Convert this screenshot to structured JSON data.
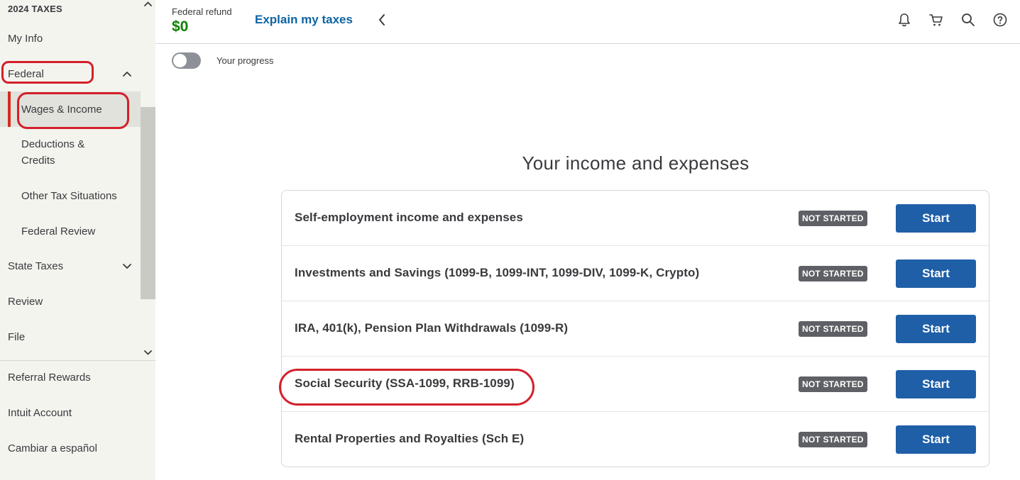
{
  "sidebar": {
    "heading": "2024 TAXES",
    "my_info": "My Info",
    "federal": "Federal",
    "federal_sub": {
      "wages": "Wages & Income",
      "deductions_line1": "Deductions &",
      "deductions_line2": "Credits",
      "other": "Other Tax Situations",
      "review": "Federal Review"
    },
    "state_taxes": "State Taxes",
    "review": "Review",
    "file": "File",
    "bottom": {
      "referral": "Referral Rewards",
      "account": "Intuit Account",
      "spanish": "Cambiar a español"
    }
  },
  "header": {
    "refund_label": "Federal refund",
    "refund_amount": "$0",
    "explain_link": "Explain my taxes",
    "icons": [
      "bell-icon",
      "cart-icon",
      "search-icon",
      "help-icon"
    ]
  },
  "progress": {
    "label": "Your progress",
    "toggle_on": false
  },
  "main": {
    "title": "Your income and expenses",
    "rows": [
      {
        "label": "Self-employment income and expenses",
        "status": "NOT STARTED",
        "action": "Start"
      },
      {
        "label": "Investments and Savings (1099-B, 1099-INT, 1099-DIV, 1099-K, Crypto)",
        "status": "NOT STARTED",
        "action": "Start"
      },
      {
        "label": "IRA, 401(k), Pension Plan Withdrawals (1099-R)",
        "status": "NOT STARTED",
        "action": "Start"
      },
      {
        "label": "Social Security (SSA-1099, RRB-1099)",
        "status": "NOT STARTED",
        "action": "Start"
      },
      {
        "label": "Rental Properties and Royalties (Sch E)",
        "status": "NOT STARTED",
        "action": "Start"
      }
    ]
  },
  "colors": {
    "accent_blue": "#1f5fa8",
    "link_blue": "#0d64a3",
    "refund_green": "#108000",
    "annotation_red": "#d3202a",
    "badge_gray": "#5f6065"
  }
}
